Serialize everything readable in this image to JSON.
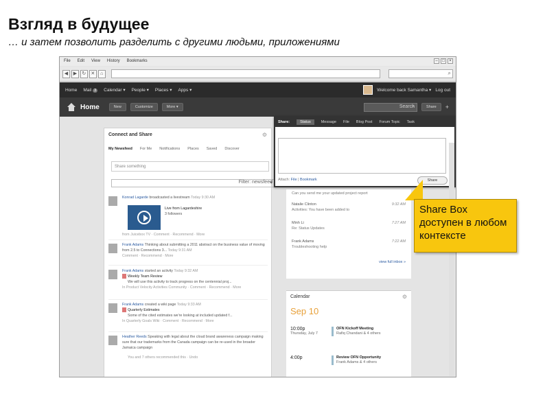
{
  "slide": {
    "title": "Взгляд в будущее",
    "subtitle": "… и затем позволить разделить с другими людьми, приложениями"
  },
  "browser": {
    "menu": [
      "File",
      "Edit",
      "View",
      "History",
      "Bookmarks"
    ]
  },
  "topbar": {
    "items": [
      "Home",
      "Mail",
      "Calendar ▾",
      "People ▾",
      "Places ▾",
      "Apps ▾"
    ],
    "mail_count": "3",
    "welcome": "Welcome back Samantha ▾",
    "logout": "Log out"
  },
  "homebar": {
    "title": "Home",
    "buttons": [
      "New",
      "Customize",
      "More ▾"
    ],
    "search_placeholder": "Search",
    "share": "Share"
  },
  "panel": {
    "title": "Connect and Share",
    "tabs": [
      "My Newsfeed",
      "For Me",
      "Notifications",
      "Places",
      "Saved",
      "Discover"
    ],
    "input_placeholder": "Share something",
    "filter": "Filter: newsfeed"
  },
  "feed": [
    {
      "who": "Konrad Lagarde",
      "text": "broadcasted a livestream",
      "time": "Today 9:30 AM",
      "title": "Live from Lagardeshire",
      "extra": "3 followers",
      "meta": "from Juicebox TV · Comment · Recommend · More"
    },
    {
      "who": "Frank Adams",
      "text": "Thinking about submitting a 2011 abstract on the business value of moving from 2.5 to Connections 3...",
      "time": "Today 9:31 AM",
      "meta": "Comment · Recommend · More"
    },
    {
      "who": "Frank Adams",
      "text": "started an activity",
      "time": "Today 9:32 AM",
      "title": "Weekly Team Review",
      "extra": "We will use this activity to track progress on the centennial proj...",
      "meta": "In Product Velocity Activities Community · Comment · Recommend · More"
    },
    {
      "who": "Frank Adams",
      "text": "created a wiki page",
      "time": "Today 9:33 AM",
      "title": "Quarterly Estimates",
      "extra": "Some of the cited estimates we're looking at included updated f...",
      "meta": "In Quarterly Goals Wiki · Comment · Recommend · More"
    },
    {
      "who": "Heather Reeds",
      "text": "Speaking with legal about the cloud brand awareness campaign making sure that our trademarks from the Canada campaign can be re-used in the broader Jamaica campaign",
      "time": "",
      "meta": "You and 7 others recommended this · Undo"
    }
  ],
  "sharebox": {
    "label": "Share:",
    "tabs": [
      "Status",
      "Message",
      "File",
      "Blog Post",
      "Forum Topic",
      "Task"
    ],
    "attach": "Attach:",
    "file": "File",
    "bookmark": "Bookmark",
    "button": "Share"
  },
  "inbox": {
    "intro": "Can you send me your updated project report",
    "items": [
      {
        "who": "Natalie Clinton",
        "time": "9:32 AM",
        "sub": "Activities: You have been added to"
      },
      {
        "who": "Minh Li",
        "time": "7:27 AM",
        "sub": "Re: Status Updates"
      },
      {
        "who": "Frank Adams",
        "time": "7:22 AM",
        "sub": "Troubleshooting help"
      }
    ],
    "view": "view full inbox »"
  },
  "calendar": {
    "title": "Calendar",
    "date": "Sep 10",
    "events": [
      {
        "time": "10:00p",
        "day": "Thursday, July 7",
        "name": "OFN Kickoff Meeting",
        "detail": "Rafiq Chandani & 4 others"
      },
      {
        "time": "4:00p",
        "day": "",
        "name": "Review OFN Opportunity",
        "detail": "Frank Adams & 4 others"
      }
    ]
  },
  "callout": "Share Box доступен в любом контексте"
}
